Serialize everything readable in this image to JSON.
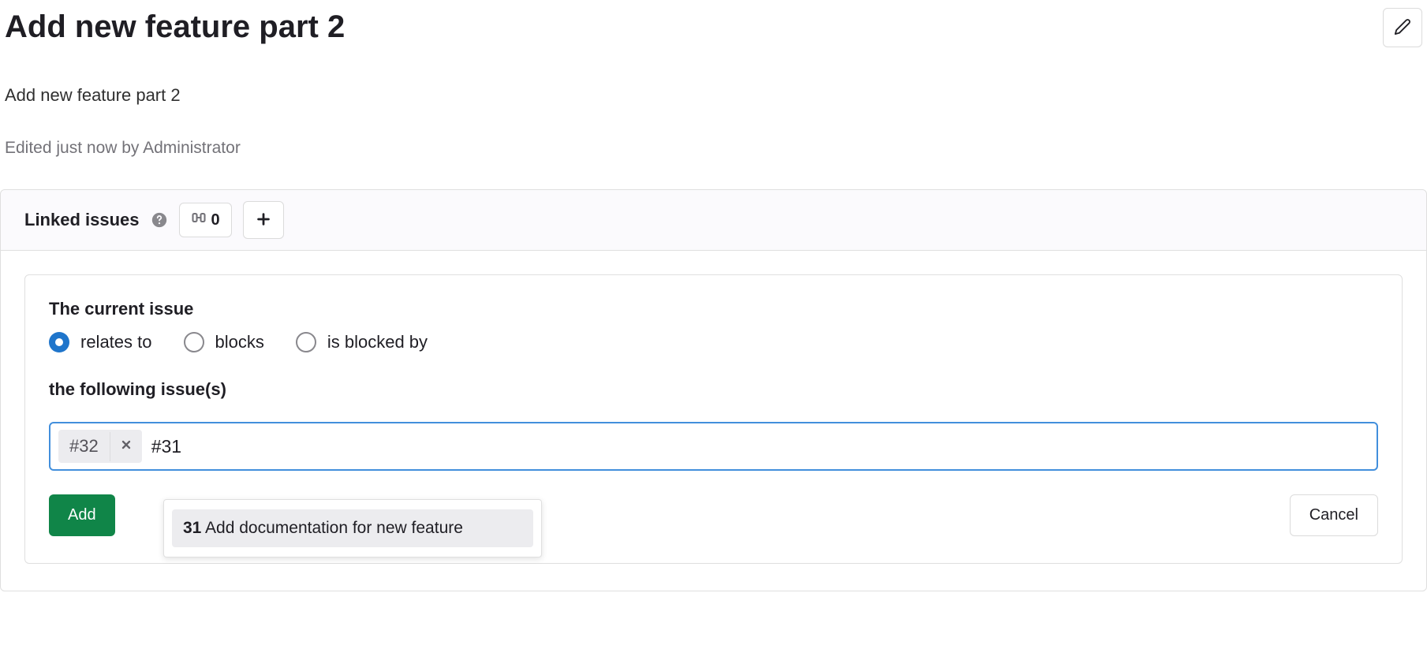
{
  "issue": {
    "title": "Add new feature part 2",
    "description": "Add new feature part 2",
    "edited_info": "Edited just now by Administrator"
  },
  "linked": {
    "header_label": "Linked issues",
    "count": "0"
  },
  "form": {
    "label_top": "The current issue",
    "options": {
      "relates_to": "relates to",
      "blocks": "blocks",
      "is_blocked_by": "is blocked by"
    },
    "selected": "relates_to",
    "label_bottom": "the following issue(s)",
    "tokens": [
      "#32"
    ],
    "input_value": "#31",
    "dropdown": {
      "number": "31",
      "title": "Add documentation for new feature"
    },
    "add_label": "Add",
    "cancel_label": "Cancel"
  }
}
